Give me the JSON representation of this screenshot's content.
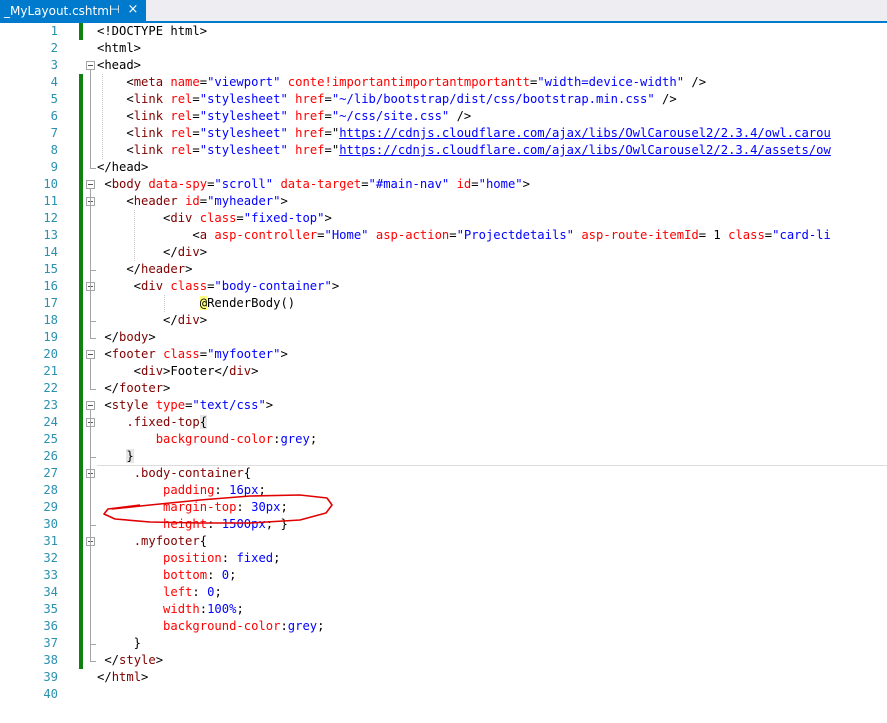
{
  "tab": {
    "title": "_MyLayout.cshtml",
    "pin_glyph": "⊣",
    "close_glyph": "×",
    "pin_icon": "pin-icon",
    "close_icon": "close-icon"
  },
  "colors": {
    "tag": "#800000",
    "attr": "#ff0000",
    "value": "#0000ff",
    "link": "#0000ff",
    "razor_at": "#000000",
    "razor_bg": "#ffff80",
    "css_selector": "#800000",
    "css_property": "#ff0000",
    "css_value": "#0000ff",
    "line_number": "#2b91af",
    "change_bar": "#108010",
    "annotation": "#e00000",
    "tab": "#007acc"
  },
  "lines": [
    {
      "n": "1",
      "parts": [
        [
          "d",
          "<!DOCTYPE html>"
        ]
      ]
    },
    {
      "n": "2",
      "parts": [
        [
          "d",
          "<html>"
        ]
      ]
    },
    {
      "n": "3",
      "parts": [
        [
          "d",
          "<head>"
        ]
      ]
    },
    {
      "n": "4",
      "parts": [
        [
          "d",
          "    <"
        ],
        [
          "t",
          "meta "
        ],
        [
          "a",
          "name"
        ],
        [
          "d",
          "="
        ],
        [
          "v",
          "\"viewport\""
        ],
        [
          "d",
          " "
        ],
        [
          "a",
          "conte!importantimportantmportantt"
        ],
        [
          "d",
          "="
        ],
        [
          "v",
          "\"width=device-width\""
        ],
        [
          "d",
          " />"
        ]
      ]
    },
    {
      "n": "5",
      "parts": [
        [
          "d",
          "    <"
        ],
        [
          "t",
          "link "
        ],
        [
          "a",
          "rel"
        ],
        [
          "d",
          "="
        ],
        [
          "v",
          "\"stylesheet\""
        ],
        [
          "d",
          " "
        ],
        [
          "a",
          "href"
        ],
        [
          "d",
          "="
        ],
        [
          "v",
          "\"~/lib/bootstrap/dist/css/bootstrap.min.css\""
        ],
        [
          "d",
          " />"
        ]
      ]
    },
    {
      "n": "6",
      "parts": [
        [
          "d",
          "    <"
        ],
        [
          "t",
          "link "
        ],
        [
          "a",
          "rel"
        ],
        [
          "d",
          "="
        ],
        [
          "v",
          "\"stylesheet\""
        ],
        [
          "d",
          " "
        ],
        [
          "a",
          "href"
        ],
        [
          "d",
          "="
        ],
        [
          "v",
          "\"~/css/site.css\""
        ],
        [
          "d",
          " />"
        ]
      ]
    },
    {
      "n": "7",
      "parts": [
        [
          "d",
          "    <"
        ],
        [
          "t",
          "link "
        ],
        [
          "a",
          "rel"
        ],
        [
          "d",
          "="
        ],
        [
          "v",
          "\"stylesheet\""
        ],
        [
          "d",
          " "
        ],
        [
          "a",
          "href"
        ],
        [
          "d",
          "=\""
        ],
        [
          "u",
          "https://cdnjs.cloudflare.com/ajax/libs/OwlCarousel2/2.3.4/owl.carou"
        ]
      ]
    },
    {
      "n": "8",
      "parts": [
        [
          "d",
          "    <"
        ],
        [
          "t",
          "link "
        ],
        [
          "a",
          "rel"
        ],
        [
          "d",
          "="
        ],
        [
          "v",
          "\"stylesheet\""
        ],
        [
          "d",
          " "
        ],
        [
          "a",
          "href"
        ],
        [
          "d",
          "=\""
        ],
        [
          "u",
          "https://cdnjs.cloudflare.com/ajax/libs/OwlCarousel2/2.3.4/assets/ow"
        ]
      ]
    },
    {
      "n": "9",
      "parts": [
        [
          "d",
          "</head>"
        ]
      ]
    },
    {
      "n": "10",
      "parts": [
        [
          "d",
          " <"
        ],
        [
          "t",
          "body "
        ],
        [
          "a",
          "data-spy"
        ],
        [
          "d",
          "="
        ],
        [
          "v",
          "\"scroll\""
        ],
        [
          "d",
          " "
        ],
        [
          "a",
          "data-target"
        ],
        [
          "d",
          "="
        ],
        [
          "v",
          "\"#main-nav\""
        ],
        [
          "d",
          " "
        ],
        [
          "a",
          "id"
        ],
        [
          "d",
          "="
        ],
        [
          "v",
          "\"home\""
        ],
        [
          "d",
          ">"
        ]
      ]
    },
    {
      "n": "11",
      "parts": [
        [
          "d",
          "    <"
        ],
        [
          "t",
          "header "
        ],
        [
          "a",
          "id"
        ],
        [
          "d",
          "="
        ],
        [
          "v",
          "\"myheader\""
        ],
        [
          "d",
          ">"
        ]
      ]
    },
    {
      "n": "12",
      "parts": [
        [
          "d",
          "         <"
        ],
        [
          "t",
          "div "
        ],
        [
          "a",
          "class"
        ],
        [
          "d",
          "="
        ],
        [
          "v",
          "\"fixed-top\""
        ],
        [
          "d",
          ">"
        ]
      ]
    },
    {
      "n": "13",
      "parts": [
        [
          "d",
          "             <"
        ],
        [
          "t",
          "a "
        ],
        [
          "a",
          "asp-controller"
        ],
        [
          "d",
          "="
        ],
        [
          "v",
          "\"Home\""
        ],
        [
          "d",
          " "
        ],
        [
          "a",
          "asp-action"
        ],
        [
          "d",
          "="
        ],
        [
          "v",
          "\"Projectdetails\""
        ],
        [
          "d",
          " "
        ],
        [
          "a",
          "asp-route-itemId"
        ],
        [
          "d",
          "= 1 "
        ],
        [
          "a",
          "class"
        ],
        [
          "d",
          "="
        ],
        [
          "v",
          "\"card-li"
        ]
      ]
    },
    {
      "n": "14",
      "parts": [
        [
          "d",
          "         </"
        ],
        [
          "t",
          "div"
        ],
        [
          "d",
          ">"
        ]
      ]
    },
    {
      "n": "15",
      "parts": [
        [
          "d",
          "    </"
        ],
        [
          "t",
          "header"
        ],
        [
          "d",
          ">"
        ]
      ]
    },
    {
      "n": "16",
      "parts": [
        [
          "d",
          "     <"
        ],
        [
          "t",
          "div "
        ],
        [
          "a",
          "class"
        ],
        [
          "d",
          "="
        ],
        [
          "v",
          "\"body-container\""
        ],
        [
          "d",
          ">"
        ]
      ]
    },
    {
      "n": "17",
      "parts": [
        [
          "d",
          "              "
        ],
        [
          "r",
          "@"
        ],
        [
          "d",
          "RenderBody()"
        ]
      ]
    },
    {
      "n": "18",
      "parts": [
        [
          "d",
          "         </"
        ],
        [
          "t",
          "div"
        ],
        [
          "d",
          ">"
        ]
      ]
    },
    {
      "n": "19",
      "parts": [
        [
          "d",
          " </"
        ],
        [
          "t",
          "body"
        ],
        [
          "d",
          ">"
        ]
      ]
    },
    {
      "n": "20",
      "parts": [
        [
          "d",
          " <"
        ],
        [
          "t",
          "footer "
        ],
        [
          "a",
          "class"
        ],
        [
          "d",
          "="
        ],
        [
          "v",
          "\"myfooter\""
        ],
        [
          "d",
          ">"
        ]
      ]
    },
    {
      "n": "21",
      "parts": [
        [
          "d",
          "     <"
        ],
        [
          "t",
          "div"
        ],
        [
          "d",
          ">Footer</"
        ],
        [
          "t",
          "div"
        ],
        [
          "d",
          ">"
        ]
      ]
    },
    {
      "n": "22",
      "parts": [
        [
          "d",
          " </"
        ],
        [
          "t",
          "footer"
        ],
        [
          "d",
          ">"
        ]
      ]
    },
    {
      "n": "23",
      "parts": [
        [
          "d",
          " <"
        ],
        [
          "t",
          "style "
        ],
        [
          "a",
          "type"
        ],
        [
          "d",
          "="
        ],
        [
          "v",
          "\"text/css\""
        ],
        [
          "d",
          ">"
        ]
      ]
    },
    {
      "n": "24",
      "parts": [
        [
          "d",
          "    "
        ],
        [
          "s",
          ".fixed-top"
        ],
        [
          "b",
          "{"
        ]
      ]
    },
    {
      "n": "25",
      "parts": [
        [
          "d",
          "        "
        ],
        [
          "p",
          "background-color"
        ],
        [
          "d",
          ":"
        ],
        [
          "c",
          "grey"
        ],
        [
          "d",
          ";"
        ]
      ]
    },
    {
      "n": "26",
      "parts": [
        [
          "d",
          "    "
        ],
        [
          "b",
          "}"
        ]
      ]
    },
    {
      "n": "27",
      "parts": [
        [
          "d",
          "     "
        ],
        [
          "s",
          ".body-container"
        ],
        [
          "d",
          "{"
        ]
      ]
    },
    {
      "n": "28",
      "parts": [
        [
          "d",
          "         "
        ],
        [
          "p",
          "padding"
        ],
        [
          "d",
          ": "
        ],
        [
          "c",
          "16px"
        ],
        [
          "d",
          ";"
        ]
      ]
    },
    {
      "n": "29",
      "parts": [
        [
          "d",
          "         "
        ],
        [
          "p",
          "margin-top"
        ],
        [
          "d",
          ": "
        ],
        [
          "c",
          "30px"
        ],
        [
          "d",
          ";"
        ]
      ]
    },
    {
      "n": "30",
      "parts": [
        [
          "d",
          "         "
        ],
        [
          "p",
          "height"
        ],
        [
          "d",
          ": "
        ],
        [
          "c",
          "1500px"
        ],
        [
          "d",
          "; }"
        ]
      ]
    },
    {
      "n": "31",
      "parts": [
        [
          "d",
          "     "
        ],
        [
          "s",
          ".myfooter"
        ],
        [
          "d",
          "{"
        ]
      ]
    },
    {
      "n": "32",
      "parts": [
        [
          "d",
          "         "
        ],
        [
          "p",
          "position"
        ],
        [
          "d",
          ": "
        ],
        [
          "c",
          "fixed"
        ],
        [
          "d",
          ";"
        ]
      ]
    },
    {
      "n": "33",
      "parts": [
        [
          "d",
          "         "
        ],
        [
          "p",
          "bottom"
        ],
        [
          "d",
          ": "
        ],
        [
          "c",
          "0"
        ],
        [
          "d",
          ";"
        ]
      ]
    },
    {
      "n": "34",
      "parts": [
        [
          "d",
          "         "
        ],
        [
          "p",
          "left"
        ],
        [
          "d",
          ": "
        ],
        [
          "c",
          "0"
        ],
        [
          "d",
          ";"
        ]
      ]
    },
    {
      "n": "35",
      "parts": [
        [
          "d",
          "         "
        ],
        [
          "p",
          "width"
        ],
        [
          "d",
          ":"
        ],
        [
          "c",
          "100%"
        ],
        [
          "d",
          ";"
        ]
      ]
    },
    {
      "n": "36",
      "parts": [
        [
          "d",
          "         "
        ],
        [
          "p",
          "background-color"
        ],
        [
          "d",
          ":"
        ],
        [
          "c",
          "grey"
        ],
        [
          "d",
          ";"
        ]
      ]
    },
    {
      "n": "37",
      "parts": [
        [
          "d",
          "     }"
        ]
      ]
    },
    {
      "n": "38",
      "parts": [
        [
          "d",
          " </"
        ],
        [
          "t",
          "style"
        ],
        [
          "d",
          ">"
        ]
      ]
    },
    {
      "n": "39",
      "parts": [
        [
          "d",
          "</"
        ],
        [
          "t",
          "html"
        ],
        [
          "d",
          ">"
        ]
      ]
    },
    {
      "n": "40",
      "parts": []
    }
  ]
}
